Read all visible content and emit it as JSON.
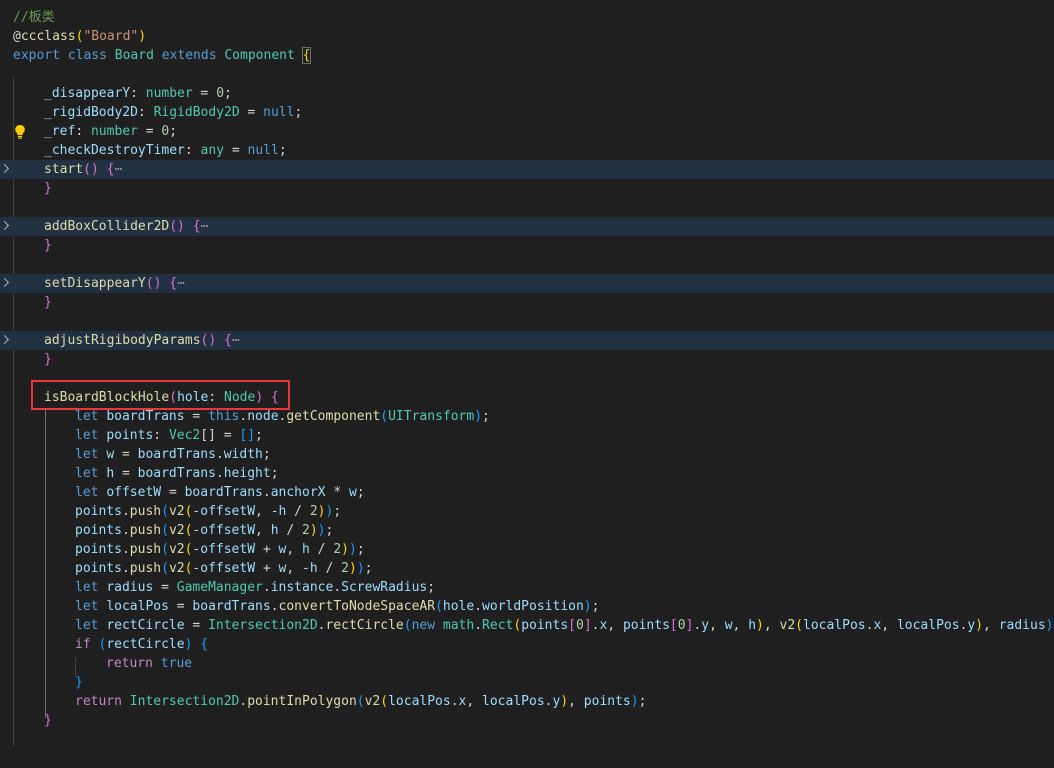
{
  "editor": {
    "comment": "//板类",
    "decorator": {
      "at": "@",
      "name": "ccclass",
      "arg": "\"Board\""
    },
    "class_decl": {
      "export_kw": "export",
      "class_kw": "class",
      "name": "Board",
      "extends_kw": "extends",
      "base": "Component"
    },
    "fields": [
      {
        "name": "_disappearY",
        "type": "number",
        "value": "0"
      },
      {
        "name": "_rigidBody2D",
        "type": "RigidBody2D",
        "value": "null"
      },
      {
        "name": "_ref",
        "type": "number",
        "value": "0"
      },
      {
        "name": "_checkDestroyTimer",
        "type": "any",
        "value": "null"
      }
    ],
    "folded_methods": [
      "start",
      "addBoxCollider2D",
      "setDisappearY",
      "adjustRigibodyParams"
    ],
    "fold_ellipsis": "⋯",
    "method": {
      "name": "isBoardBlockHole",
      "param": "hole",
      "param_type": "Node",
      "body": {
        "let": "let",
        "this": "this",
        "new": "new",
        "return": "return",
        "if": "if",
        "true": "true",
        "boardTrans": "boardTrans",
        "node": "node",
        "getComponent": "getComponent",
        "UITransform": "UITransform",
        "points": "points",
        "Vec2": "Vec2",
        "w": "w",
        "h": "h",
        "width": "width",
        "height": "height",
        "offsetW": "offsetW",
        "anchorX": "anchorX",
        "push": "push",
        "v2": "v2",
        "two": "2",
        "zero": "0",
        "radius": "radius",
        "GameManager": "GameManager",
        "instance": "instance",
        "ScrewRadius": "ScrewRadius",
        "localPos": "localPos",
        "convertToNodeSpaceAR": "convertToNodeSpaceAR",
        "hole": "hole",
        "worldPosition": "worldPosition",
        "rectCircle": "rectCircle",
        "Intersection2D": "Intersection2D",
        "math": "math",
        "Rect": "Rect",
        "x": "x",
        "y": "y",
        "pointInPolygon": "pointInPolygon"
      }
    }
  }
}
